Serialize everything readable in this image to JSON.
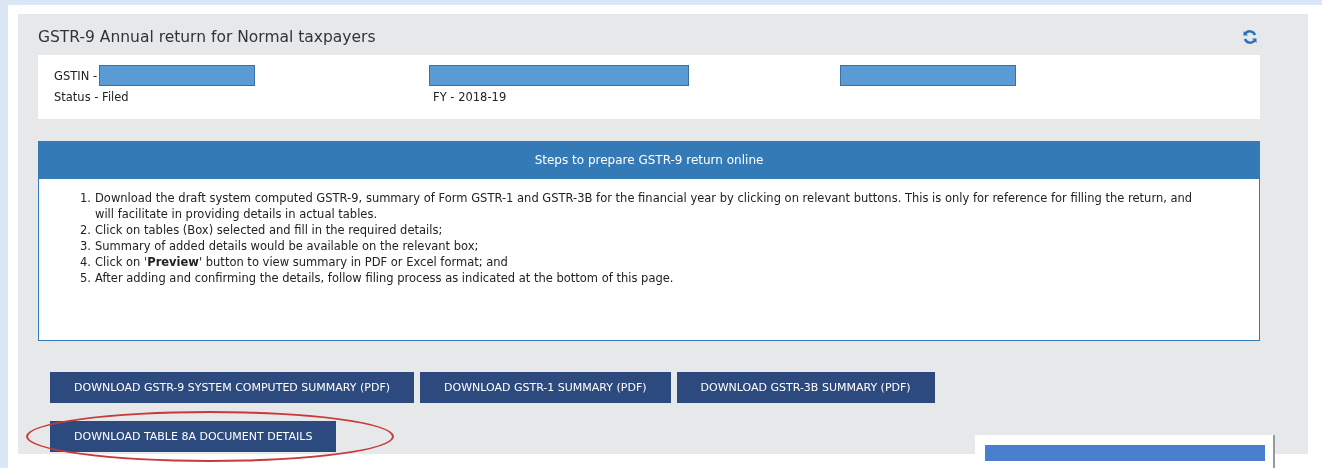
{
  "panel": {
    "title": "GSTR-9 Annual return for Normal taxpayers"
  },
  "info": {
    "gstin_label": "GSTIN -",
    "status": "Status - Filed",
    "fy": "FY - 2018-19"
  },
  "steps": {
    "heading": "Steps to prepare GSTR-9 return online",
    "numbers": [
      "1.",
      "2.",
      "3.",
      "4.",
      "5."
    ],
    "items": [
      "Download the draft system computed GSTR-9, summary of Form GSTR-1 and GSTR-3B for the financial year by clicking on relevant buttons. This is only for reference for filling the return, and will facilitate in providing details in actual tables.",
      "Click on tables (Box) selected and fill in the required details;",
      "Summary of added details would be available on the relevant box;",
      "Click on '**Preview**' button to view summary in PDF or Excel format; and",
      "After adding and confirming the details, follow filing process as indicated at the bottom of this page."
    ]
  },
  "buttons": [
    {
      "label": "DOWNLOAD GSTR-9 SYSTEM COMPUTED SUMMARY (PDF)",
      "circled": false
    },
    {
      "label": "DOWNLOAD GSTR-1 SUMMARY (PDF)",
      "circled": false
    },
    {
      "label": "DOWNLOAD GSTR-3B SUMMARY (PDF)",
      "circled": false
    },
    {
      "label": "DOWNLOAD TABLE 8A DOCUMENT DETAILS",
      "circled": true
    }
  ]
}
